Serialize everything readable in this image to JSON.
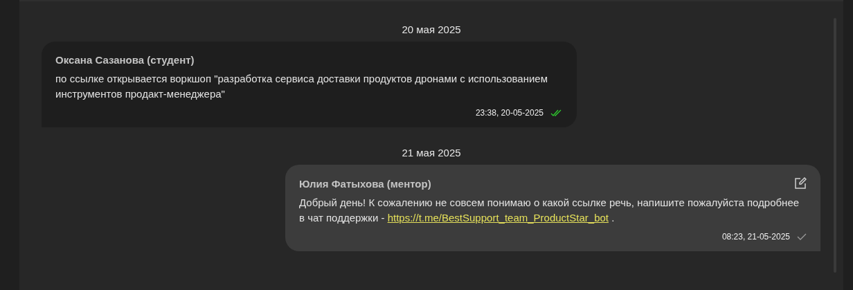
{
  "feed": [
    {
      "kind": "date",
      "label": "20 мая 2025"
    },
    {
      "kind": "message",
      "outgoing": false,
      "author": "Оксана Сазанова (студент)",
      "text": "по ссылке открывается воркшоп \"разработка сервиса доставки продуктов дронами с использованием инструментов продакт-менеджера\"",
      "time": "23:38, 20-05-2025",
      "read": true,
      "editable": false
    },
    {
      "kind": "date",
      "label": "21 мая 2025"
    },
    {
      "kind": "message",
      "outgoing": true,
      "author": "Юлия Фатыхова (ментор)",
      "text": "Добрый день! К сожалению не совсем понимаю о какой ссылке речь, напишите пожалуйста подробнее в чат поддержки - ",
      "link": "https://t.me/BestSupport_team_ProductStar_bot",
      "text_after": " .",
      "time": "08:23, 21-05-2025",
      "read": false,
      "editable": true
    }
  ]
}
